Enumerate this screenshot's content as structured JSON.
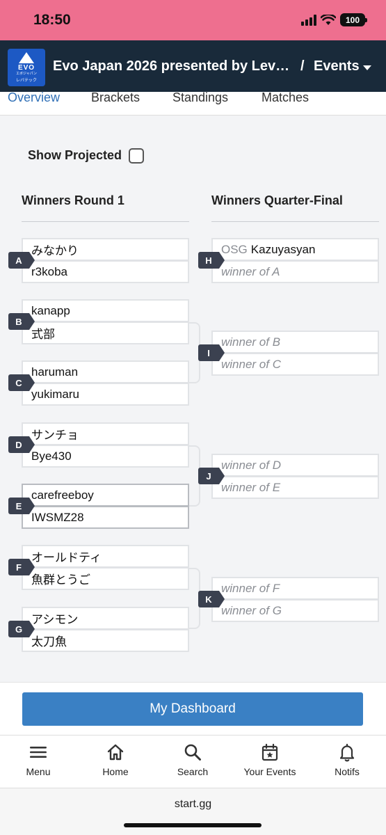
{
  "status": {
    "time": "18:50",
    "battery": "100"
  },
  "header": {
    "logo_text": "EVO",
    "logo_sub": "エボジャパン",
    "logo_sponsor": "レバテック",
    "title": "Evo Japan 2026 presented by Levtech",
    "separator": "/",
    "section": "Events"
  },
  "tabs": [
    "Overview",
    "Brackets",
    "Standings",
    "Matches"
  ],
  "projected": {
    "label": "Show Projected",
    "checked": false
  },
  "rounds": {
    "r1": "Winners Round 1",
    "qf": "Winners Quarter-Final"
  },
  "matches_r1": [
    {
      "id": "A",
      "top": "みなかり",
      "bottom": "r3koba"
    },
    {
      "id": "B",
      "top": "kanapp",
      "bottom": "式部"
    },
    {
      "id": "C",
      "top": "haruman",
      "bottom": "yukimaru"
    },
    {
      "id": "D",
      "top": "サンチョ",
      "bottom": "Bye430"
    },
    {
      "id": "E",
      "top": "carefreeboy",
      "bottom": "IWSMZ28"
    },
    {
      "id": "F",
      "top": "オールドティ",
      "bottom": "魚群とうご"
    },
    {
      "id": "G",
      "top": "アシモン",
      "bottom": "太刀魚"
    }
  ],
  "matches_qf": [
    {
      "id": "H",
      "top_prefix": "OSG",
      "top": "Kazuyasyan",
      "bottom": "winner of A"
    },
    {
      "id": "I",
      "top_prefix": "",
      "top": "winner of B",
      "bottom": "winner of C"
    },
    {
      "id": "J",
      "top_prefix": "",
      "top": "winner of D",
      "bottom": "winner of E"
    },
    {
      "id": "K",
      "top_prefix": "",
      "top": "winner of F",
      "bottom": "winner of G"
    }
  ],
  "dashboard": {
    "label": "My Dashboard"
  },
  "nav": [
    {
      "label": "Menu",
      "icon": "menu-icon"
    },
    {
      "label": "Home",
      "icon": "home-icon"
    },
    {
      "label": "Search",
      "icon": "search-icon"
    },
    {
      "label": "Your Events",
      "icon": "calendar-star-icon"
    },
    {
      "label": "Notifs",
      "icon": "bell-icon"
    }
  ],
  "browser": {
    "url": "start.gg"
  }
}
